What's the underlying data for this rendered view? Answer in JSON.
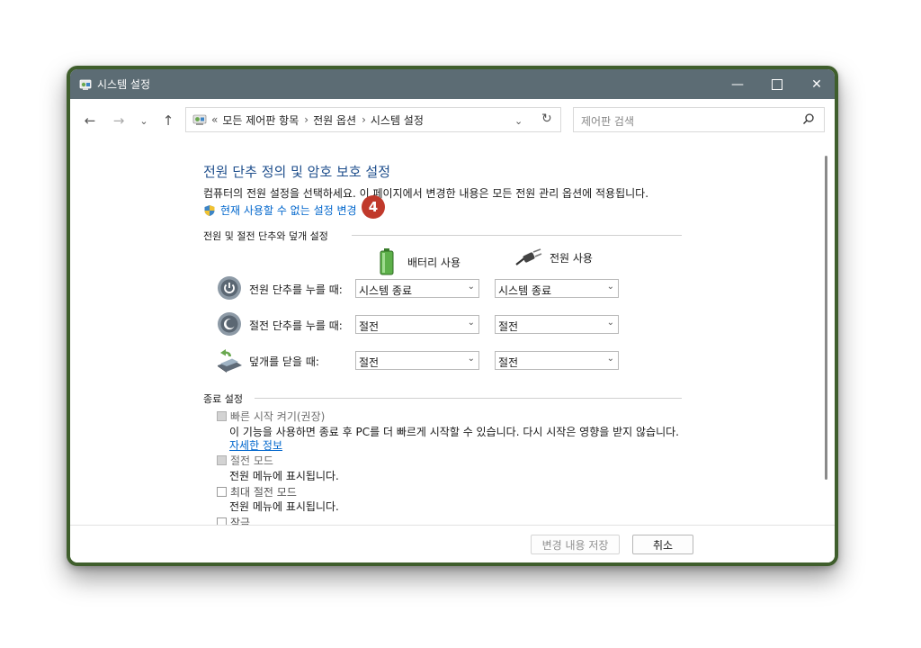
{
  "window": {
    "title": "시스템 설정"
  },
  "address": {
    "overflow": "«",
    "crumbs": [
      "모든 제어판 항목",
      "전원 옵션",
      "시스템 설정"
    ],
    "separator": "›"
  },
  "search": {
    "placeholder": "제어판 검색"
  },
  "main": {
    "heading": "전원 단추 정의 및 암호 보호 설정",
    "description": "컴퓨터의 전원 설정을 선택하세요. 이 페이지에서 변경한 내용은 모든 전원 관리 옵션에 적용됩니다.",
    "change_link": "현재 사용할 수 없는 설정 변경",
    "step_badge": "4"
  },
  "power_section": {
    "title": "전원 및 절전 단추와 덮개 설정",
    "battery_label": "배터리 사용",
    "plugged_label": "전원 사용",
    "rows": [
      {
        "label": "전원 단추를 누를 때:",
        "battery": "시스템 종료",
        "plugged": "시스템 종료"
      },
      {
        "label": "절전 단추를 누를 때:",
        "battery": "절전",
        "plugged": "절전"
      },
      {
        "label": "덮개를 닫을 때:",
        "battery": "절전",
        "plugged": "절전"
      }
    ]
  },
  "shutdown_section": {
    "title": "종료 설정",
    "fast_startup": {
      "label": "빠른 시작 켜기(권장)",
      "desc": "이 기능을 사용하면 종료 후 PC를 더 빠르게 시작할 수 있습니다. 다시 시작은 영향을 받지 않습니다.",
      "link": "자세한 정보",
      "checked": true
    },
    "sleep": {
      "label": "절전 모드",
      "desc": "전원 메뉴에 표시됩니다.",
      "checked": true
    },
    "hibernate": {
      "label": "최대 절전 모드",
      "desc": "전원 메뉴에 표시됩니다.",
      "checked": false
    },
    "lock": {
      "label": "잠금"
    }
  },
  "footer": {
    "save_label": "변경 내용 저장",
    "cancel_label": "취소"
  },
  "colors": {
    "accent_link": "#0066cc",
    "heading": "#1e4e8c",
    "badge": "#c0392b",
    "window_border": "#3f5e2c",
    "titlebar": "#5c6c74"
  }
}
